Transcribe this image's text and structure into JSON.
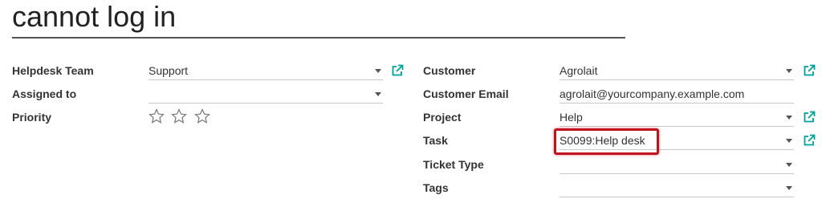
{
  "title": "cannot log in",
  "left": {
    "helpdesk_team": {
      "label": "Helpdesk Team",
      "value": "Support"
    },
    "assigned_to": {
      "label": "Assigned to",
      "value": ""
    },
    "priority": {
      "label": "Priority",
      "stars_total": 3,
      "stars_filled": 0
    }
  },
  "right": {
    "customer": {
      "label": "Customer",
      "value": "Agrolait"
    },
    "customer_email": {
      "label": "Customer Email",
      "value": "agrolait@yourcompany.example.com"
    },
    "project": {
      "label": "Project",
      "value": "Help"
    },
    "task": {
      "label": "Task",
      "value": "S0099:Help desk"
    },
    "ticket_type": {
      "label": "Ticket Type",
      "value": ""
    },
    "tags": {
      "label": "Tags",
      "value": ""
    }
  },
  "colors": {
    "link_icon": "#00a09d",
    "highlight": "#c1121f"
  },
  "icons": [
    "external-link-icon",
    "dropdown-caret-icon",
    "star-outline-icon"
  ]
}
